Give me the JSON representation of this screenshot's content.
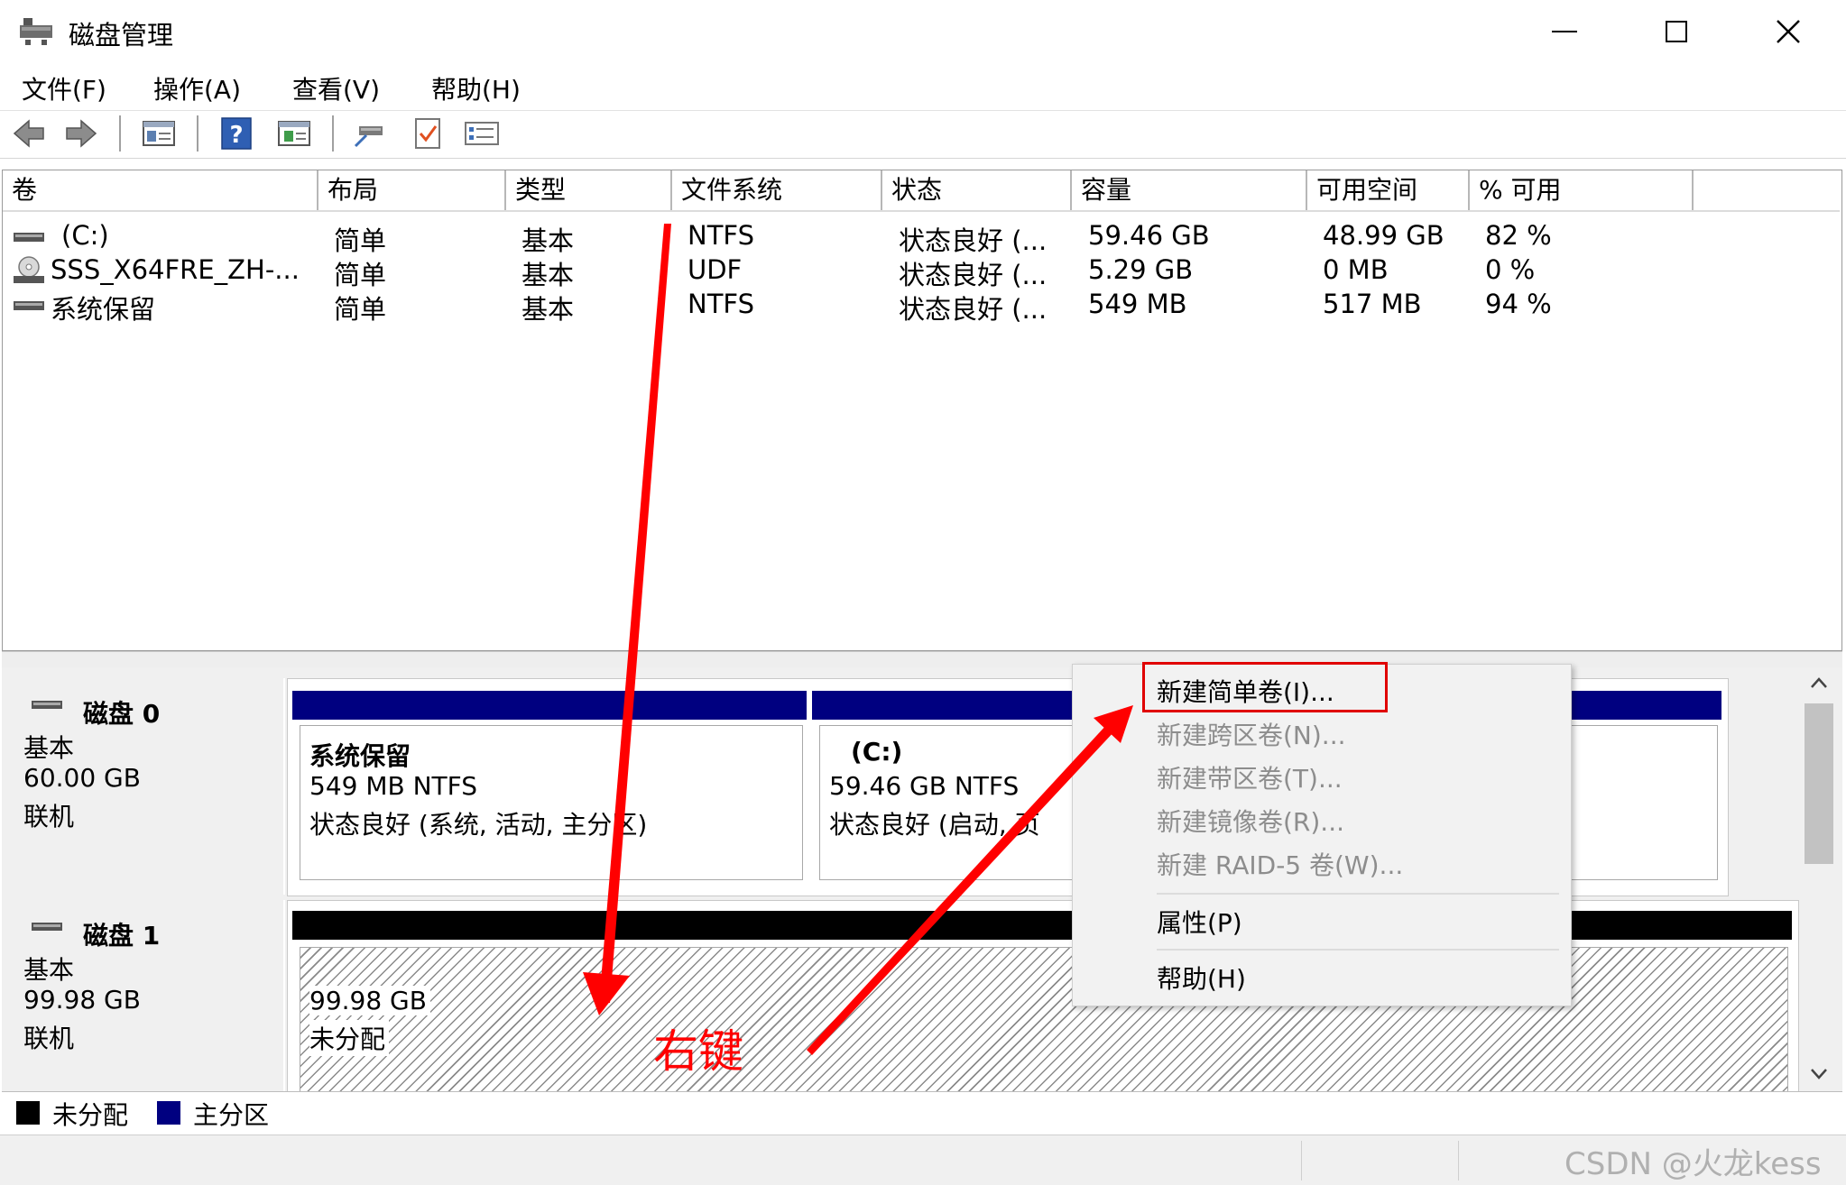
{
  "window": {
    "title": "磁盘管理",
    "minimize_glyph": "—",
    "maximize_glyph": "☐",
    "close_glyph": "✕"
  },
  "menu": [
    "文件(F)",
    "操作(A)",
    "查看(V)",
    "帮助(H)"
  ],
  "toolbar": {
    "icons": [
      "back-icon",
      "forward-icon",
      "console-tree-icon",
      "help-icon",
      "details-icon",
      "connect-icon",
      "check-icon",
      "properties-list-icon"
    ]
  },
  "volume_table": {
    "columns": [
      "卷",
      "布局",
      "类型",
      "文件系统",
      "状态",
      "容量",
      "可用空间",
      "% 可用"
    ],
    "rows": [
      {
        "icon": "drive-icon",
        "name": "(C:)",
        "layout": "简单",
        "type": "基本",
        "fs": "NTFS",
        "status": "状态良好 (...",
        "capacity": "59.46 GB",
        "free": "48.99 GB",
        "pct": "82 %"
      },
      {
        "icon": "cd-drive-icon",
        "name": "SSS_X64FRE_ZH-...",
        "layout": "简单",
        "type": "基本",
        "fs": "UDF",
        "status": "状态良好 (...",
        "capacity": "5.29 GB",
        "free": "0 MB",
        "pct": "0 %"
      },
      {
        "icon": "drive-icon",
        "name": "系统保留",
        "layout": "简单",
        "type": "基本",
        "fs": "NTFS",
        "status": "状态良好 (...",
        "capacity": "549 MB",
        "free": "517 MB",
        "pct": "94 %"
      }
    ]
  },
  "disks": [
    {
      "name": "磁盘 0",
      "kind": "基本",
      "size": "60.00 GB",
      "state": "联机",
      "partitions": [
        {
          "title": "系统保留",
          "size": "549 MB NTFS",
          "status": "状态良好 (系统, 活动, 主分区)"
        },
        {
          "title": "(C:)",
          "size": "59.46 GB NTFS",
          "status": "状态良好 (启动, 页"
        }
      ]
    },
    {
      "name": "磁盘 1",
      "kind": "基本",
      "size": "99.98 GB",
      "state": "联机",
      "partitions": [
        {
          "size": "99.98 GB",
          "status": "未分配"
        }
      ]
    }
  ],
  "legend": [
    {
      "label": "未分配",
      "color": "#000000"
    },
    {
      "label": "主分区",
      "color": "#000080"
    }
  ],
  "context_menu": {
    "items": [
      {
        "label": "新建简单卷(I)...",
        "enabled": true,
        "highlighted": true
      },
      {
        "label": "新建跨区卷(N)...",
        "enabled": false
      },
      {
        "label": "新建带区卷(T)...",
        "enabled": false
      },
      {
        "label": "新建镜像卷(R)...",
        "enabled": false
      },
      {
        "label": "新建 RAID-5 卷(W)...",
        "enabled": false
      },
      {
        "label": "属性(P)",
        "enabled": true
      },
      {
        "label": "帮助(H)",
        "enabled": true
      }
    ]
  },
  "annotation": {
    "text": "右键",
    "color": "#ff0000"
  },
  "watermark": "CSDN @火龙kess",
  "colors": {
    "primary_partition": "#000080",
    "unallocated": "#000000",
    "highlight_box": "#e00000"
  }
}
